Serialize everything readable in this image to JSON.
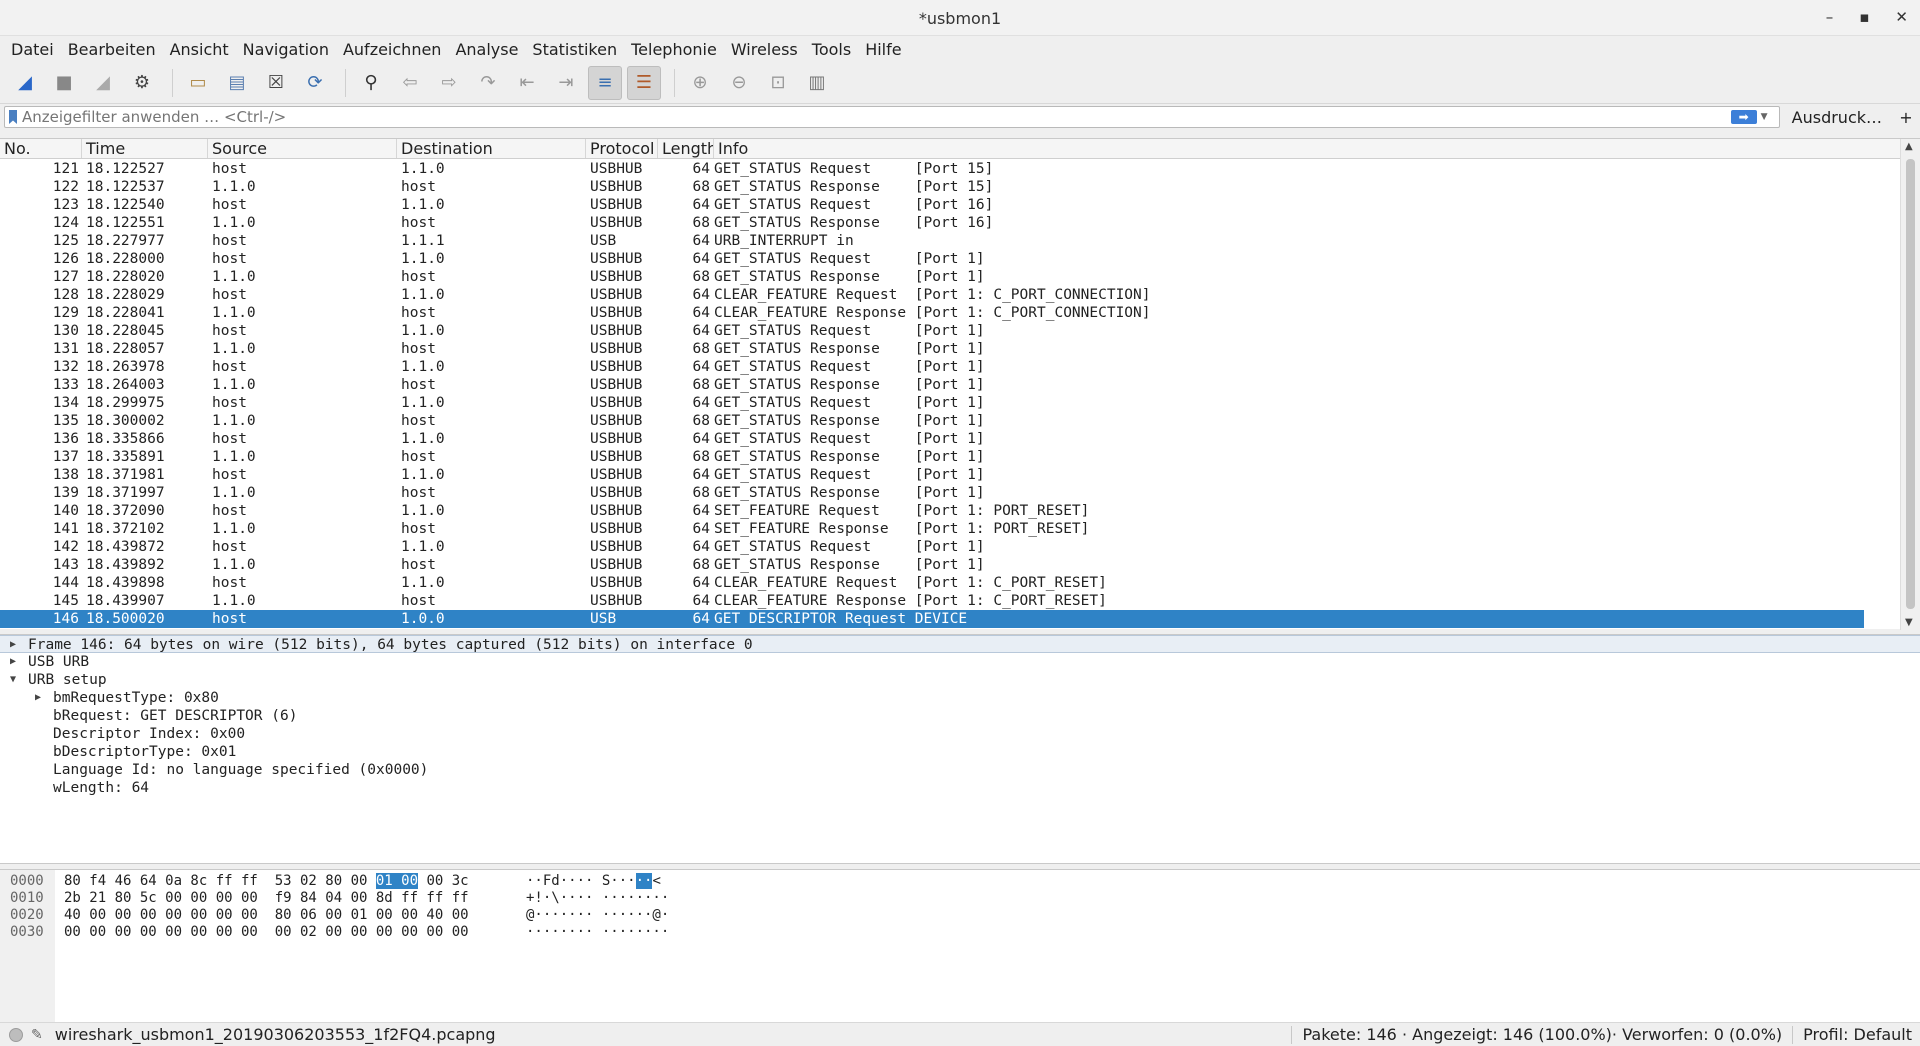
{
  "window": {
    "title": "*usbmon1"
  },
  "menu": [
    "Datei",
    "Bearbeiten",
    "Ansicht",
    "Navigation",
    "Aufzeichnen",
    "Analyse",
    "Statistiken",
    "Telephonie",
    "Wireless",
    "Tools",
    "Hilfe"
  ],
  "toolbar": {
    "icons": [
      "shark-fin-start-icon",
      "stop-icon",
      "restart-icon",
      "capture-options-icon",
      "open-file-icon",
      "save-file-icon",
      "close-file-icon",
      "reload-icon",
      "find-packet-icon",
      "go-back-icon",
      "go-forward-icon",
      "go-to-packet-icon",
      "go-first-icon",
      "go-last-icon",
      "autoscroll-icon",
      "colorize-icon",
      "zoom-in-icon",
      "zoom-out-icon",
      "normal-size-icon",
      "resize-columns-icon"
    ]
  },
  "filter": {
    "placeholder": "Anzeigefilter anwenden … <Ctrl-/>",
    "expression_label": "Ausdruck…",
    "add_label": "+"
  },
  "packet_list": {
    "columns": [
      "No.",
      "Time",
      "Source",
      "Destination",
      "Protocol",
      "Length",
      "Info"
    ],
    "rows": [
      [
        "121",
        "18.122527",
        "host",
        "1.1.0",
        "USBHUB",
        "64",
        "GET_STATUS Request     [Port 15]"
      ],
      [
        "122",
        "18.122537",
        "1.1.0",
        "host",
        "USBHUB",
        "68",
        "GET_STATUS Response    [Port 15]"
      ],
      [
        "123",
        "18.122540",
        "host",
        "1.1.0",
        "USBHUB",
        "64",
        "GET_STATUS Request     [Port 16]"
      ],
      [
        "124",
        "18.122551",
        "1.1.0",
        "host",
        "USBHUB",
        "68",
        "GET_STATUS Response    [Port 16]"
      ],
      [
        "125",
        "18.227977",
        "host",
        "1.1.1",
        "USB",
        "64",
        "URB_INTERRUPT in"
      ],
      [
        "126",
        "18.228000",
        "host",
        "1.1.0",
        "USBHUB",
        "64",
        "GET_STATUS Request     [Port 1]"
      ],
      [
        "127",
        "18.228020",
        "1.1.0",
        "host",
        "USBHUB",
        "68",
        "GET_STATUS Response    [Port 1]"
      ],
      [
        "128",
        "18.228029",
        "host",
        "1.1.0",
        "USBHUB",
        "64",
        "CLEAR_FEATURE Request  [Port 1: C_PORT_CONNECTION]"
      ],
      [
        "129",
        "18.228041",
        "1.1.0",
        "host",
        "USBHUB",
        "64",
        "CLEAR_FEATURE Response [Port 1: C_PORT_CONNECTION]"
      ],
      [
        "130",
        "18.228045",
        "host",
        "1.1.0",
        "USBHUB",
        "64",
        "GET_STATUS Request     [Port 1]"
      ],
      [
        "131",
        "18.228057",
        "1.1.0",
        "host",
        "USBHUB",
        "68",
        "GET_STATUS Response    [Port 1]"
      ],
      [
        "132",
        "18.263978",
        "host",
        "1.1.0",
        "USBHUB",
        "64",
        "GET_STATUS Request     [Port 1]"
      ],
      [
        "133",
        "18.264003",
        "1.1.0",
        "host",
        "USBHUB",
        "68",
        "GET_STATUS Response    [Port 1]"
      ],
      [
        "134",
        "18.299975",
        "host",
        "1.1.0",
        "USBHUB",
        "64",
        "GET_STATUS Request     [Port 1]"
      ],
      [
        "135",
        "18.300002",
        "1.1.0",
        "host",
        "USBHUB",
        "68",
        "GET_STATUS Response    [Port 1]"
      ],
      [
        "136",
        "18.335866",
        "host",
        "1.1.0",
        "USBHUB",
        "64",
        "GET_STATUS Request     [Port 1]"
      ],
      [
        "137",
        "18.335891",
        "1.1.0",
        "host",
        "USBHUB",
        "68",
        "GET_STATUS Response    [Port 1]"
      ],
      [
        "138",
        "18.371981",
        "host",
        "1.1.0",
        "USBHUB",
        "64",
        "GET_STATUS Request     [Port 1]"
      ],
      [
        "139",
        "18.371997",
        "1.1.0",
        "host",
        "USBHUB",
        "68",
        "GET_STATUS Response    [Port 1]"
      ],
      [
        "140",
        "18.372090",
        "host",
        "1.1.0",
        "USBHUB",
        "64",
        "SET_FEATURE Request    [Port 1: PORT_RESET]"
      ],
      [
        "141",
        "18.372102",
        "1.1.0",
        "host",
        "USBHUB",
        "64",
        "SET_FEATURE Response   [Port 1: PORT_RESET]"
      ],
      [
        "142",
        "18.439872",
        "host",
        "1.1.0",
        "USBHUB",
        "64",
        "GET_STATUS Request     [Port 1]"
      ],
      [
        "143",
        "18.439892",
        "1.1.0",
        "host",
        "USBHUB",
        "68",
        "GET_STATUS Response    [Port 1]"
      ],
      [
        "144",
        "18.439898",
        "host",
        "1.1.0",
        "USBHUB",
        "64",
        "CLEAR_FEATURE Request  [Port 1: C_PORT_RESET]"
      ],
      [
        "145",
        "18.439907",
        "1.1.0",
        "host",
        "USBHUB",
        "64",
        "CLEAR_FEATURE Response [Port 1: C_PORT_RESET]"
      ],
      [
        "146",
        "18.500020",
        "host",
        "1.0.0",
        "USB",
        "64",
        "GET DESCRIPTOR Request DEVICE"
      ]
    ],
    "selected_no": "146"
  },
  "details": [
    {
      "text": "Frame 146: 64 bytes on wire (512 bits), 64 bytes captured (512 bits) on interface 0",
      "level": 0,
      "toggle": "collapsed",
      "highlight": true
    },
    {
      "text": "USB URB",
      "level": 0,
      "toggle": "collapsed"
    },
    {
      "text": "URB setup",
      "level": 0,
      "toggle": "expanded"
    },
    {
      "text": "bmRequestType: 0x80",
      "level": 1,
      "toggle": "collapsed"
    },
    {
      "text": "bRequest: GET DESCRIPTOR (6)",
      "level": 1,
      "toggle": "none"
    },
    {
      "text": "Descriptor Index: 0x00",
      "level": 1,
      "toggle": "none"
    },
    {
      "text": "bDescriptorType: 0x01",
      "level": 1,
      "toggle": "none"
    },
    {
      "text": "Language Id: no language specified (0x0000)",
      "level": 1,
      "toggle": "none"
    },
    {
      "text": "wLength: 64",
      "level": 1,
      "toggle": "none"
    }
  ],
  "hex": [
    {
      "offset": "0000",
      "pre": "80 f4 46 64 0a 8c ff ff  53 02 80 00 ",
      "sel": "01 00",
      "post": " 00 3c",
      "ascii_pre": "··Fd···· S···",
      "ascii_sel": "··",
      "ascii_post": "<"
    },
    {
      "offset": "0010",
      "pre": "2b 21 80 5c 00 00 00 00  f9 84 04 00 8d ff ff ff",
      "sel": "",
      "post": "",
      "ascii_pre": "+!·\\···· ········",
      "ascii_sel": "",
      "ascii_post": ""
    },
    {
      "offset": "0020",
      "pre": "40 00 00 00 00 00 00 00  80 06 00 01 00 00 40 00",
      "sel": "",
      "post": "",
      "ascii_pre": "@······· ······@·",
      "ascii_sel": "",
      "ascii_post": ""
    },
    {
      "offset": "0030",
      "pre": "00 00 00 00 00 00 00 00  00 02 00 00 00 00 00 00",
      "sel": "",
      "post": "",
      "ascii_pre": "········ ········",
      "ascii_sel": "",
      "ascii_post": ""
    }
  ],
  "status": {
    "file": "wireshark_usbmon1_20190306203553_1f2FQ4.pcapng",
    "stats": "Pakete: 146 · Angezeigt: 146 (100.0%)· Verworfen: 0 (0.0%)",
    "profile": "Profil: Default"
  },
  "colors": {
    "selection": "#2f83c6",
    "accent": "#3c7fd8"
  }
}
